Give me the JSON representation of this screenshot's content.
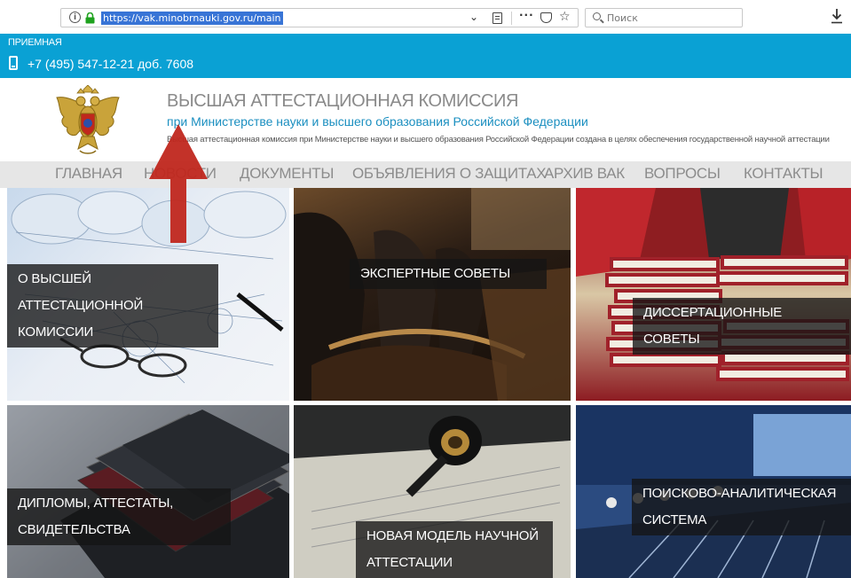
{
  "browser": {
    "url": "https://vak.minobrnauki.gov.ru/main",
    "info_icon": "info-icon",
    "search_placeholder": "Поиск"
  },
  "topbar": {
    "label": "ПРИЕМНАЯ",
    "phone": "+7 (495) 547-12-21 доб. 7608",
    "color": "#0aa1d4"
  },
  "brand": {
    "title": "ВЫСШАЯ АТТЕСТАЦИОННАЯ КОМИССИЯ",
    "subtitle": "при Министерстве науки и высшего образования Российской Федерации",
    "description": "Высшая аттестационная комиссия при Министерстве науки и высшего образования Российской Федерации создана в целях обеспечения государственной научной аттестации"
  },
  "nav": {
    "items": [
      "ГЛАВНАЯ",
      "НОВОСТИ",
      "ДОКУМЕНТЫ",
      "ОБЪЯВЛЕНИЯ О ЗАЩИТАХ",
      "АРХИВ ВАК",
      "ВОПРОСЫ",
      "КОНТАКТЫ"
    ]
  },
  "tiles": [
    {
      "lines": [
        "О ВЫСШЕЙ АТТЕСТАЦИОННОЙ",
        "КОМИССИИ"
      ]
    },
    {
      "lines": [
        "ЭКСПЕРТНЫЕ СОВЕТЫ"
      ]
    },
    {
      "lines": [
        "ДИССЕРТАЦИОННЫЕ СОВЕТЫ"
      ]
    },
    {
      "lines": [
        "ДИПЛОМЫ, АТТЕСТАТЫ,",
        "СВИДЕТЕЛЬСТВА"
      ]
    },
    {
      "lines": [
        "НОВАЯ МОДЕЛЬ НАУЧНОЙ",
        "АТТЕСТАЦИИ"
      ]
    },
    {
      "lines": [
        "ПОИСКОВО-АНАЛИТИЧЕСКАЯ",
        "СИСТЕМА"
      ]
    }
  ],
  "annotation": {
    "color": "#c0271d"
  }
}
